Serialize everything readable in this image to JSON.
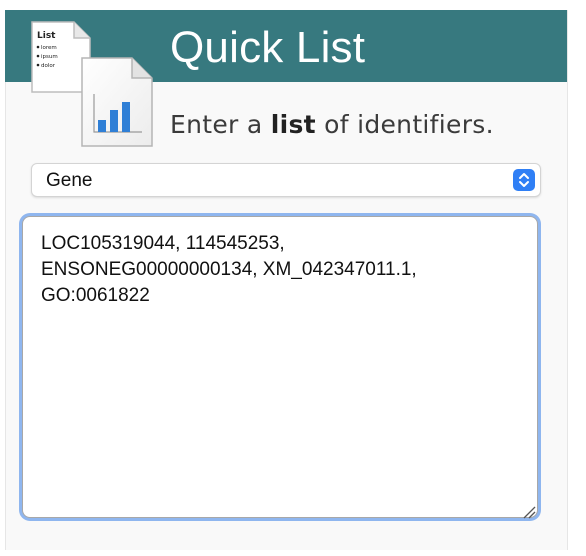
{
  "header": {
    "title": "Quick List"
  },
  "icon": {
    "name": "quick-list-document-icon",
    "back_doc_lines": [
      "List",
      "lorem",
      "ipsum",
      "dolor"
    ],
    "bar_color": "#2f7fd6"
  },
  "instruction": {
    "prefix": "Enter a ",
    "emphasis": "list",
    "suffix": " of identifiers."
  },
  "type_select": {
    "selected": "Gene"
  },
  "identifiers_input": {
    "value": "LOC105319044, 114545253,\nENSONEG00000000134, XM_042347011.1,\nGO:0061822"
  },
  "colors": {
    "header_bg": "#37797f",
    "focus_ring": "#8fb6ef",
    "select_arrow_bg": "#2f7ff5"
  }
}
